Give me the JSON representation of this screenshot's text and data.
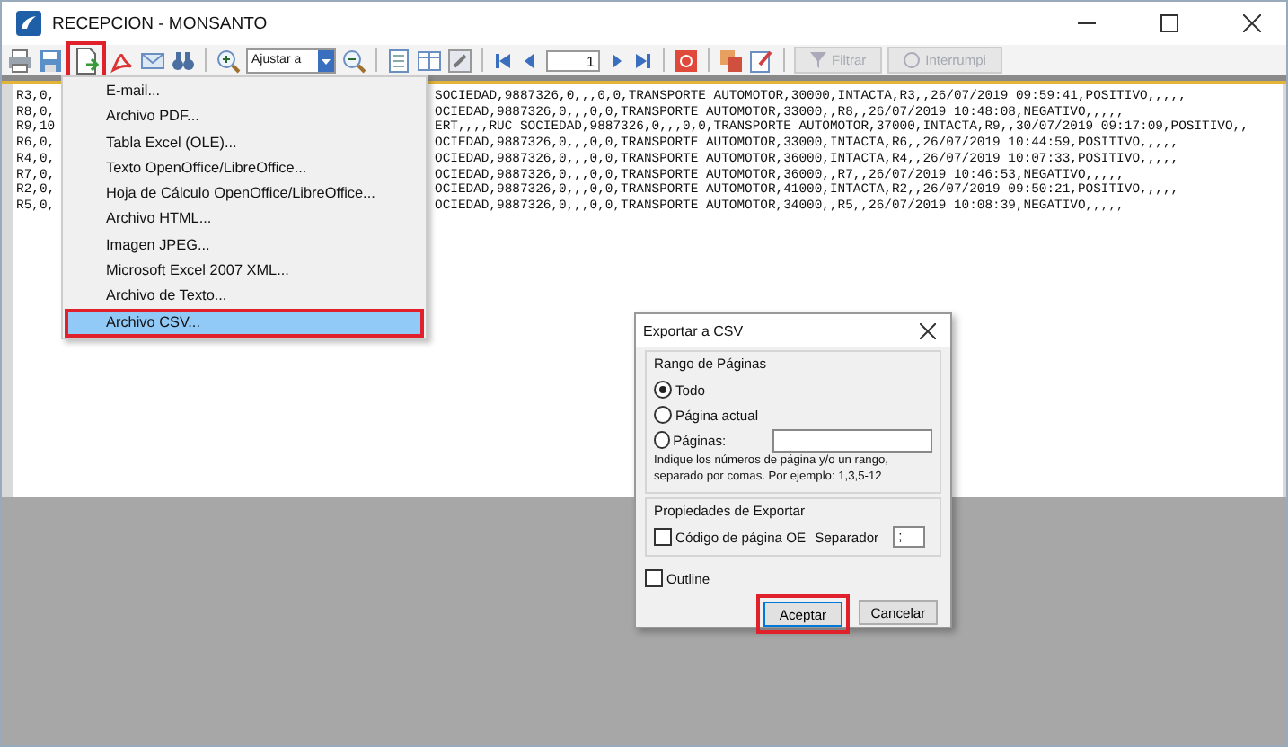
{
  "window": {
    "title": "RECEPCION - MONSANTO"
  },
  "toolbar": {
    "export_annotated": true,
    "zoom_value": "Ajustar a",
    "page": "1",
    "buttons": [
      {
        "label": "Filtrar",
        "disabled": true
      },
      {
        "label": "Interrumpi",
        "disabled": true
      }
    ]
  },
  "report_lines": [
    {
      "left": "R3,0,",
      "right": "SOCIEDAD,9887326,0,,,0,0,TRANSPORTE AUTOMOTOR,30000,INTACTA,R3,,26/07/2019 09:59:41,POSITIVO,,,,,"
    },
    {
      "left": "R8,0,",
      "right": "OCIEDAD,9887326,0,,,0,0,TRANSPORTE AUTOMOTOR,33000,,R8,,26/07/2019 10:48:08,NEGATIVO,,,,,"
    },
    {
      "left": "R9,10",
      "right": "ERT,,,,RUC SOCIEDAD,9887326,0,,,0,0,TRANSPORTE AUTOMOTOR,37000,INTACTA,R9,,30/07/2019 09:17:09,POSITIVO,,"
    },
    {
      "left": "R6,0,",
      "right": "OCIEDAD,9887326,0,,,0,0,TRANSPORTE AUTOMOTOR,33000,INTACTA,R6,,26/07/2019 10:44:59,POSITIVO,,,,,"
    },
    {
      "left": "R4,0,",
      "right": "OCIEDAD,9887326,0,,,0,0,TRANSPORTE AUTOMOTOR,36000,INTACTA,R4,,26/07/2019 10:07:33,POSITIVO,,,,,"
    },
    {
      "left": "R7,0,",
      "right": "OCIEDAD,9887326,0,,,0,0,TRANSPORTE AUTOMOTOR,36000,,R7,,26/07/2019 10:46:53,NEGATIVO,,,,,"
    },
    {
      "left": "R2,0,",
      "right": "OCIEDAD,9887326,0,,,0,0,TRANSPORTE AUTOMOTOR,41000,INTACTA,R2,,26/07/2019 09:50:21,POSITIVO,,,,,"
    },
    {
      "left": "R5,0,",
      "right": "OCIEDAD,9887326,0,,,0,0,TRANSPORTE AUTOMOTOR,34000,,R5,,26/07/2019 10:08:39,NEGATIVO,,,,,"
    }
  ],
  "export_menu": {
    "items": [
      {
        "label": "E-mail...",
        "selected": false,
        "annotated": false
      },
      {
        "label": "Archivo PDF...",
        "selected": false,
        "annotated": false
      },
      {
        "label": "Tabla Excel (OLE)...",
        "selected": false,
        "annotated": false
      },
      {
        "label": "Texto OpenOffice/LibreOffice...",
        "selected": false,
        "annotated": false
      },
      {
        "label": "Hoja de Cálculo OpenOffice/LibreOffice...",
        "selected": false,
        "annotated": false
      },
      {
        "label": "Archivo HTML...",
        "selected": false,
        "annotated": false
      },
      {
        "label": "Imagen JPEG...",
        "selected": false,
        "annotated": false
      },
      {
        "label": "Microsoft Excel 2007 XML...",
        "selected": false,
        "annotated": false
      },
      {
        "label": "Archivo de Texto...",
        "selected": false,
        "annotated": false
      },
      {
        "label": "Archivo CSV...",
        "selected": true,
        "annotated": true
      }
    ]
  },
  "dialog": {
    "title": "Exportar a CSV",
    "range_group": {
      "title": "Rango de Páginas",
      "options": [
        {
          "label": "Todo",
          "selected": true
        },
        {
          "label": "Página actual",
          "selected": false
        },
        {
          "label": "Páginas:",
          "selected": false
        }
      ],
      "hint": "Indique los números de página y/o un rango, separado por comas. Por ejemplo: 1,3,5-12"
    },
    "properties_group": {
      "title": "Propiedades de Exportar",
      "checkbox": {
        "label": "Código de página OE",
        "checked": false
      },
      "separator_label": "Separador",
      "separator_value": ";"
    },
    "outline": {
      "label": "Outline",
      "checked": false
    },
    "buttons": [
      {
        "label": "Aceptar",
        "default": true,
        "annotated": true
      },
      {
        "label": "Cancelar",
        "default": false,
        "annotated": false
      }
    ]
  }
}
